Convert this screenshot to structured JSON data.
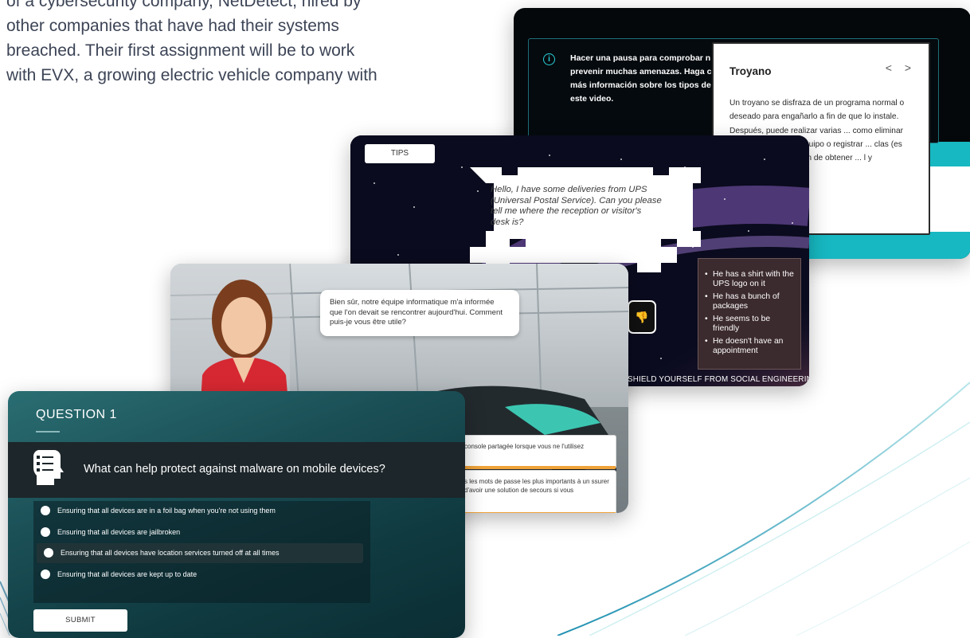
{
  "intro": {
    "lines": [
      "of a cybersecurity company, NetDetect, hired by",
      "other companies that have had their systems",
      "breached. Their first assignment will be to work",
      "with EVX, a growing electric vehicle company with"
    ]
  },
  "spanish_card": {
    "info_icon": "info-icon",
    "info_text": "Hacer una pausa para comprobar n\nprevenir muchas amenazas. Haga c\nmás información sobre los tipos de\neste video.",
    "popover": {
      "title": "Troyano",
      "nav": "< >",
      "body": "Un troyano se disfraza de un programa normal o deseado para engañarlo a fin de que lo instale. Después, puede realizar varias ... como eliminar archivos, ... to a su equipo o registrar ... clas (es decir, rastrear las ... fin de obtener ... l y contraseñas)."
    },
    "accent_color": "#17b8c2"
  },
  "space_card": {
    "tips_label": "TIPS",
    "speech": "Hello, I have some deliveries from UPS\n(Universal Postal Service). Can you please\ntell me where the reception or visitor's\ndesk is?",
    "clues": [
      "He has a shirt with the UPS logo on it",
      "He has a bunch of packages",
      "He seems to be friendly",
      "He doesn't have an appointment"
    ],
    "thumb_icon": "thumbs-down-icon",
    "footer": "SHIELD YOURSELF FROM SOCIAL ENGINEERING"
  },
  "french_card": {
    "speech": "Bien sûr, notre équipe informatique m'a informée\nque l'on devait se rencontrer aujourd'hui. Comment\npuis-je vous être utile?",
    "answers": [
      "console partagée lorsque vous ne l'utilisez",
      "s les mots de passe les plus importants à un ssurer d'avoir une solution de secours si vous"
    ],
    "accent_color": "#f0a33a"
  },
  "quiz_card": {
    "title": "QUESTION 1",
    "question_icon": "checklist-head-icon",
    "question": "What can help protect against malware on mobile devices?",
    "options": [
      "Ensuring that all devices are in a foil bag when you're not using them",
      "Ensuring that all devices are jailbroken",
      "Ensuring that all devices have location services turned off at all times",
      "Ensuring that all devices are kept up to date"
    ],
    "selected_option_index": 2,
    "submit_label": "SUBMIT"
  }
}
